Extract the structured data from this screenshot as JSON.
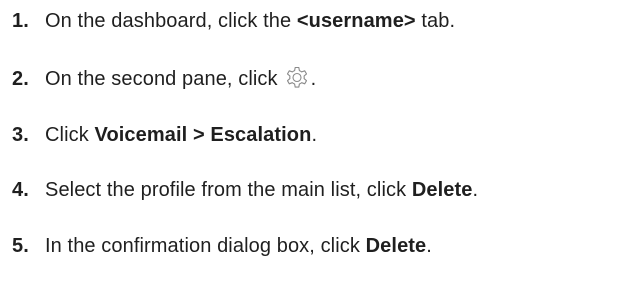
{
  "steps": [
    {
      "number": "1.",
      "pre": "On the dashboard, click the ",
      "bold": "<username>",
      "post": " tab."
    },
    {
      "number": "2.",
      "pre": "On the second pane, click",
      "icon": "gear-icon",
      "post": "."
    },
    {
      "number": "3.",
      "pre": "Click ",
      "bold": "Voicemail > Escalation",
      "post": "."
    },
    {
      "number": "4.",
      "pre": "Select the profile from the main list, click ",
      "bold": "Delete",
      "post": "."
    },
    {
      "number": "5.",
      "pre": "In the confirmation dialog box, click ",
      "bold": "Delete",
      "post": "."
    }
  ]
}
